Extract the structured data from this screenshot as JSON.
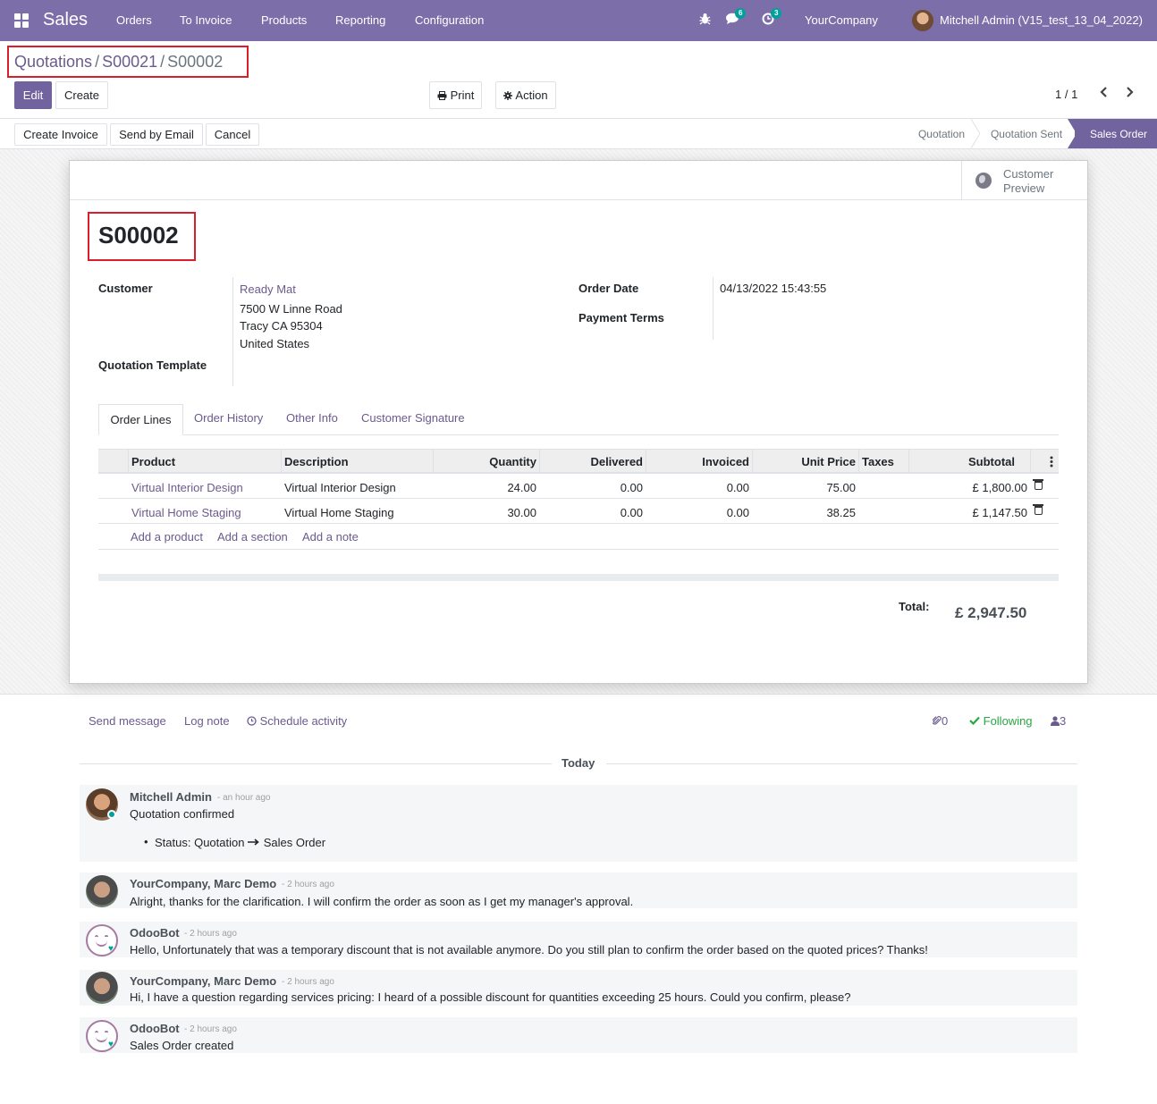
{
  "navbar": {
    "app_name": "Sales",
    "menu": [
      "Orders",
      "To Invoice",
      "Products",
      "Reporting",
      "Configuration"
    ],
    "messages_count": "6",
    "activities_count": "3",
    "company": "YourCompany",
    "user": "Mitchell Admin (V15_test_13_04_2022)"
  },
  "breadcrumb": {
    "first": "Quotations",
    "second": "S00021",
    "current": "S00002",
    "separator": "/"
  },
  "control": {
    "edit_label": "Edit",
    "create_label": "Create",
    "print_label": "Print",
    "action_label": "Action",
    "pager": "1 / 1"
  },
  "statusbar": {
    "buttons": [
      "Create Invoice",
      "Send by Email",
      "Cancel"
    ],
    "stages": [
      "Quotation",
      "Quotation Sent",
      "Sales Order"
    ],
    "active_stage": "Sales Order"
  },
  "sheet": {
    "preview_label_line1": "Customer",
    "preview_label_line2": "Preview",
    "name": "S00002",
    "labels": {
      "customer": "Customer",
      "template": "Quotation Template",
      "order_date": "Order Date",
      "payment_terms": "Payment Terms"
    },
    "customer": {
      "name": "Ready Mat",
      "street": "7500 W Linne Road",
      "city": "Tracy CA 95304",
      "country": "United States"
    },
    "order_date": "04/13/2022 15:43:55",
    "tabs": [
      "Order Lines",
      "Order History",
      "Other Info",
      "Customer Signature"
    ],
    "table": {
      "columns": [
        "Product",
        "Description",
        "Quantity",
        "Delivered",
        "Invoiced",
        "Unit Price",
        "Taxes",
        "Subtotal"
      ],
      "rows": [
        {
          "product": "Virtual Interior Design",
          "description": "Virtual Interior Design",
          "quantity": "24.00",
          "delivered": "0.00",
          "invoiced": "0.00",
          "unit_price": "75.00",
          "taxes": "",
          "subtotal": "£ 1,800.00"
        },
        {
          "product": "Virtual Home Staging",
          "description": "Virtual Home Staging",
          "quantity": "30.00",
          "delivered": "0.00",
          "invoiced": "0.00",
          "unit_price": "38.25",
          "taxes": "",
          "subtotal": "£ 1,147.50"
        }
      ],
      "add_links": [
        "Add a product",
        "Add a section",
        "Add a note"
      ]
    },
    "total_label": "Total:",
    "total_value": "£ 2,947.50"
  },
  "chatter": {
    "send_message": "Send message",
    "log_note": "Log note",
    "schedule_activity": "Schedule activity",
    "attachments": "0",
    "following": "Following",
    "followers": "3",
    "today": "Today",
    "messages": [
      {
        "author": "Mitchell Admin",
        "time": "- an hour ago",
        "body": "Quotation confirmed",
        "tracking": "Status: Quotation",
        "tracking_new": "Sales Order"
      },
      {
        "author": "YourCompany, Marc Demo",
        "time": "- 2 hours ago",
        "body": "Alright, thanks for the clarification. I will confirm the order as soon as I get my manager's approval."
      },
      {
        "author": "OdooBot",
        "time": "- 2 hours ago",
        "body": "Hello, Unfortunately that was a temporary discount that is not available anymore. Do you still plan to confirm the order based on the quoted prices? Thanks!"
      },
      {
        "author": "YourCompany, Marc Demo",
        "time": "- 2 hours ago",
        "body": "Hi, I have a question regarding services pricing: I heard of a possible discount for quantities exceeding 25 hours. Could you confirm, please?"
      },
      {
        "author": "OdooBot",
        "time": "- 2 hours ago",
        "body": "Sales Order created"
      }
    ]
  },
  "colors": {
    "brand": "#7c6ea9",
    "primary": "#71639e",
    "link": "#6b5a8e",
    "highlight_box": "#d9202a",
    "following": "#28a745",
    "online": "#00a09d"
  }
}
